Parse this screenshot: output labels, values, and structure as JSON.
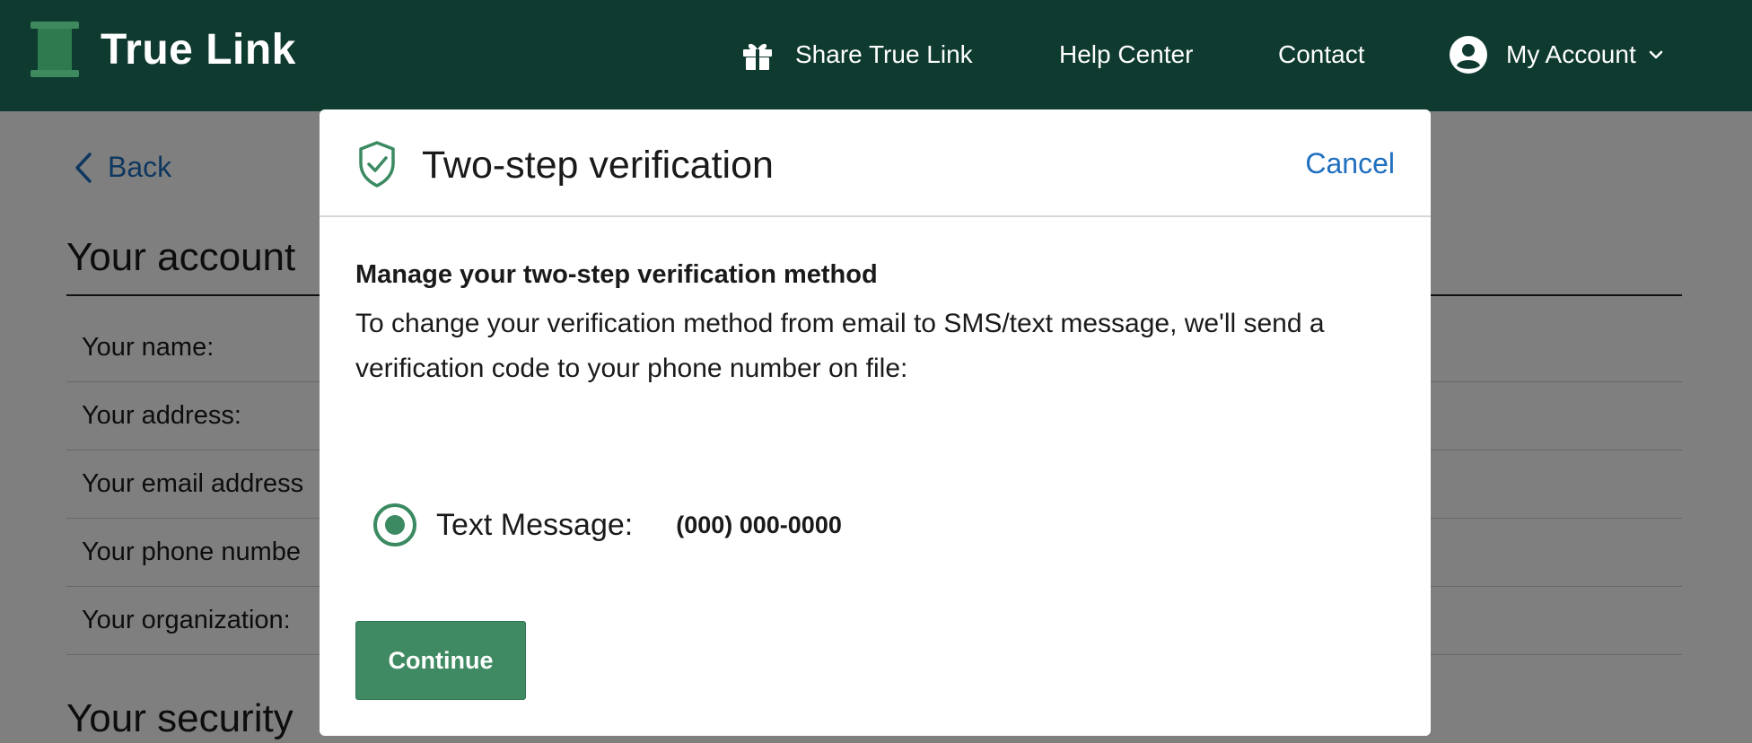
{
  "header": {
    "brand": "True Link",
    "nav": {
      "share": "Share True Link",
      "help": "Help Center",
      "contact": "Contact",
      "account": "My Account"
    }
  },
  "page": {
    "back": "Back",
    "account_title": "Your account",
    "rows": [
      "Your name:",
      "Your address:",
      "Your email address",
      "Your phone numbe",
      "Your organization:"
    ],
    "security_title": "Your security"
  },
  "modal": {
    "title": "Two-step verification",
    "cancel": "Cancel",
    "heading": "Manage your two-step verification method",
    "description": "To change your verification method from email to SMS/text message, we'll send a verification code to your phone number on file:",
    "option_label": "Text Message:",
    "option_phone": "(000) 000-0000",
    "continue": "Continue"
  },
  "colors": {
    "header_bg": "#0f3a30",
    "brand_green": "#3f8a62",
    "link_blue": "#1f6fbf"
  },
  "icons": [
    "logo-spool-icon",
    "gift-icon",
    "account-circle-icon",
    "chevron-down-icon",
    "chevron-left-icon",
    "shield-check-icon"
  ]
}
